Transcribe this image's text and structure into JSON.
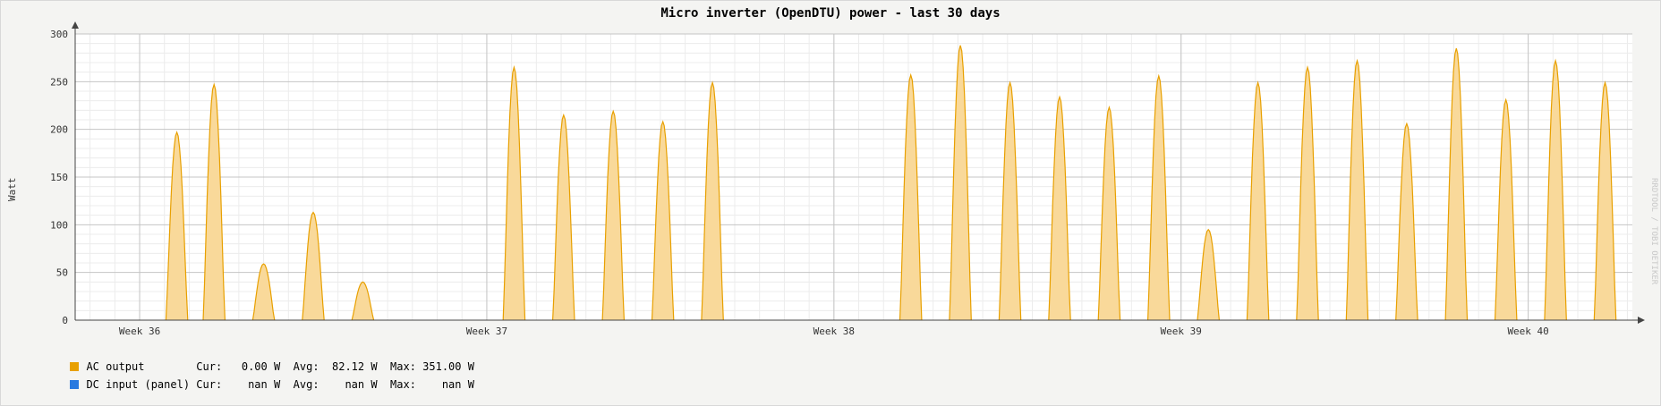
{
  "chart_data": {
    "type": "area",
    "title": "Micro inverter (OpenDTU) power - last 30 days",
    "xlabel": "",
    "ylabel": "Watt",
    "ylim": [
      0,
      300
    ],
    "yticks": [
      0,
      50,
      100,
      150,
      200,
      250,
      300
    ],
    "x_unit": "days",
    "xlim": [
      -1.3,
      30.1
    ],
    "xticks": [
      {
        "label": "Week 36",
        "x": 0
      },
      {
        "label": "Week 37",
        "x": 7
      },
      {
        "label": "Week 38",
        "x": 14
      },
      {
        "label": "Week 39",
        "x": 21
      },
      {
        "label": "Week 40",
        "x": 28
      }
    ],
    "grid": true,
    "legend_position": "bottom-left",
    "series": [
      {
        "name": "AC output",
        "color": "#e8a000",
        "fill": "#f9d99a",
        "peaks": [
          {
            "x": 0.75,
            "y": 197
          },
          {
            "x": 1.5,
            "y": 247
          },
          {
            "x": 2.5,
            "y": 59
          },
          {
            "x": 3.5,
            "y": 113
          },
          {
            "x": 4.5,
            "y": 40
          },
          {
            "x": 7.55,
            "y": 265
          },
          {
            "x": 8.55,
            "y": 215
          },
          {
            "x": 9.55,
            "y": 219
          },
          {
            "x": 10.55,
            "y": 208
          },
          {
            "x": 11.55,
            "y": 249
          },
          {
            "x": 15.55,
            "y": 257
          },
          {
            "x": 16.55,
            "y": 288
          },
          {
            "x": 17.55,
            "y": 249
          },
          {
            "x": 18.55,
            "y": 234
          },
          {
            "x": 19.55,
            "y": 223
          },
          {
            "x": 20.55,
            "y": 256
          },
          {
            "x": 21.55,
            "y": 95
          },
          {
            "x": 22.55,
            "y": 249
          },
          {
            "x": 23.55,
            "y": 265
          },
          {
            "x": 24.55,
            "y": 272
          },
          {
            "x": 25.55,
            "y": 206
          },
          {
            "x": 26.55,
            "y": 285
          },
          {
            "x": 27.55,
            "y": 231
          },
          {
            "x": 28.55,
            "y": 272
          },
          {
            "x": 29.55,
            "y": 249
          }
        ]
      },
      {
        "name": "DC input (panel)",
        "color": "#2a7be0",
        "peaks": []
      }
    ]
  },
  "legend": {
    "ac": {
      "label": "AC output        ",
      "stats": "Cur:   0.00 W  Avg:  82.12 W  Max: 351.00 W"
    },
    "dc": {
      "label": "DC input (panel) ",
      "stats": "Cur:    nan W  Avg:    nan W  Max:    nan W"
    }
  },
  "watermark": "RRDTOOL / TOBI OETIKER"
}
